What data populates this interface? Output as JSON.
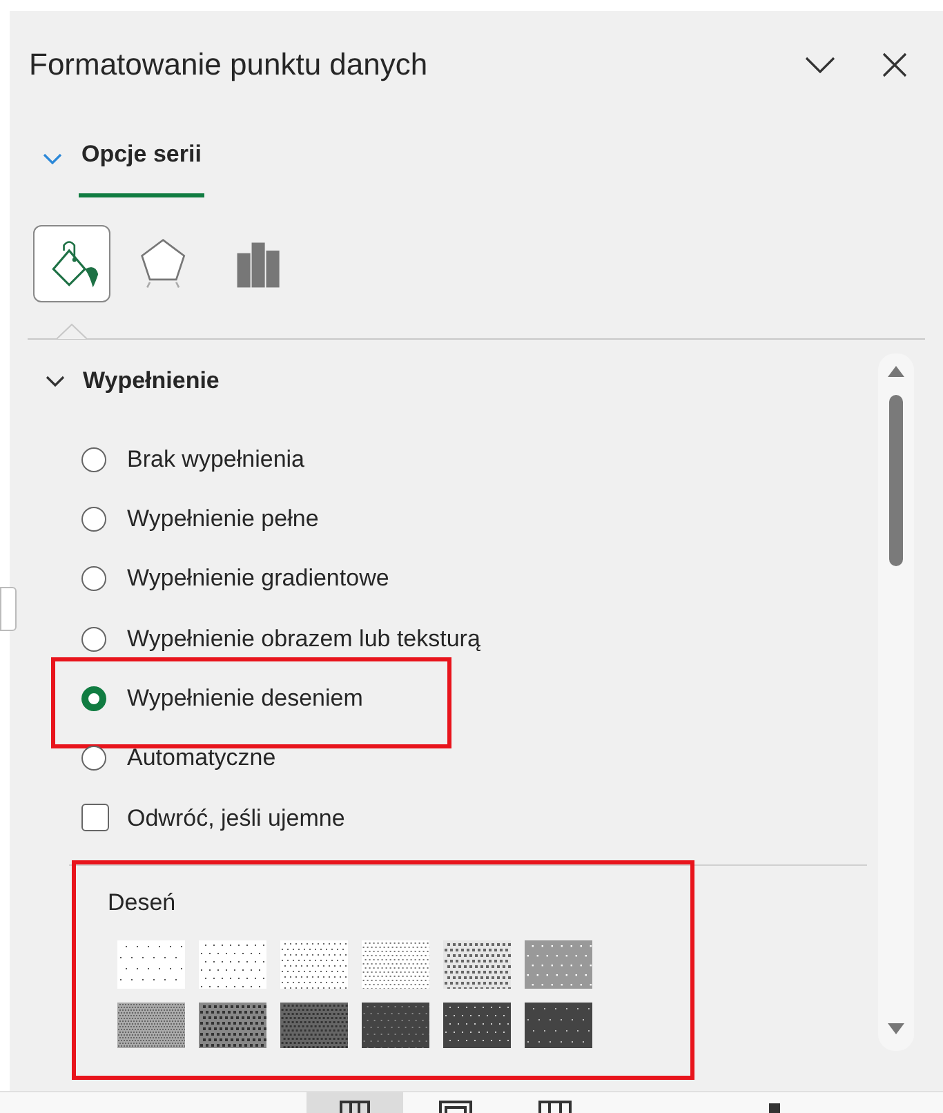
{
  "panel": {
    "title": "Formatowanie punktu danych"
  },
  "tabs": [
    {
      "label": "Opcje serii",
      "selected": true
    }
  ],
  "category_icons": [
    {
      "kind": "fill",
      "selected": true
    },
    {
      "kind": "effects",
      "selected": false
    },
    {
      "kind": "series",
      "selected": false
    }
  ],
  "section": {
    "title": "Wypełnienie",
    "expanded": true,
    "options": [
      {
        "kind": "radio",
        "label": "Brak wypełnienia",
        "selected": false,
        "highlighted": false
      },
      {
        "kind": "radio",
        "label": "Wypełnienie pełne",
        "selected": false,
        "highlighted": false
      },
      {
        "kind": "radio",
        "label": "Wypełnienie gradientowe",
        "selected": false,
        "highlighted": false
      },
      {
        "kind": "radio",
        "label": "Wypełnienie obrazem lub teksturą",
        "selected": false,
        "highlighted": false
      },
      {
        "kind": "radio",
        "label": "Wypełnienie deseniem",
        "selected": true,
        "highlighted": true
      },
      {
        "kind": "radio",
        "label": "Automatyczne",
        "selected": false,
        "highlighted": false
      },
      {
        "kind": "checkbox",
        "label": "Odwróć, jeśli ujemne",
        "checked": false,
        "highlighted": false
      }
    ],
    "pattern": {
      "label": "Deseń",
      "highlighted": true
    }
  }
}
